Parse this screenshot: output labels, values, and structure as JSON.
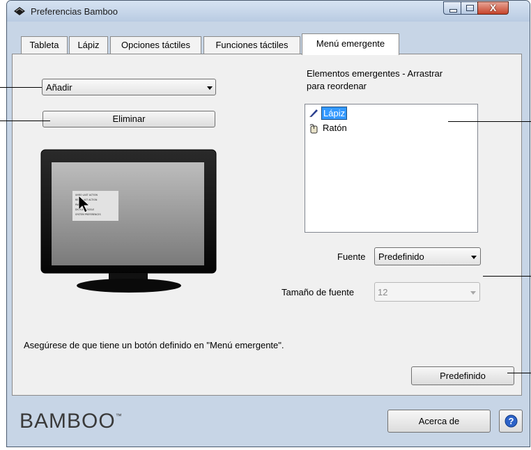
{
  "window": {
    "title": "Preferencias Bamboo"
  },
  "tabs": [
    {
      "label": "Tableta"
    },
    {
      "label": "Lápiz"
    },
    {
      "label": "Opciones táctiles"
    },
    {
      "label": "Funciones táctiles"
    },
    {
      "label": "Menú emergente",
      "active": true
    }
  ],
  "left": {
    "action_select_value": "Añadir",
    "delete_button": "Eliminar"
  },
  "preview": {
    "menu_lines": [
      "UNDO LAST ACTION",
      "REDO LAST ACTION",
      "PAN/SCROLL",
      "DISPLAY TOGGLE",
      "SYSTEM PREFERENCES"
    ]
  },
  "popup_items": {
    "label_line1": "Elementos emergentes - Arrastrar",
    "label_line2": "para reordenar",
    "items": [
      {
        "label": "Lápiz",
        "icon": "pen-icon",
        "selected": true
      },
      {
        "label": "Ratón",
        "icon": "mouse-icon",
        "selected": false
      }
    ]
  },
  "font": {
    "font_label": "Fuente",
    "font_value": "Predefinido",
    "size_label": "Tamaño de fuente",
    "size_value": "12"
  },
  "notice": "Asegúrese de que tiene un botón definido en \"Menú emergente\".",
  "defaults_button": "Predefinido",
  "footer": {
    "logo": "BAMBOO",
    "about_button": "Acerca de",
    "help_icon": "help-icon"
  },
  "colors": {
    "selection": "#3399ff",
    "window_frame": "#c7d5e6",
    "close_button": "#c6442b"
  }
}
